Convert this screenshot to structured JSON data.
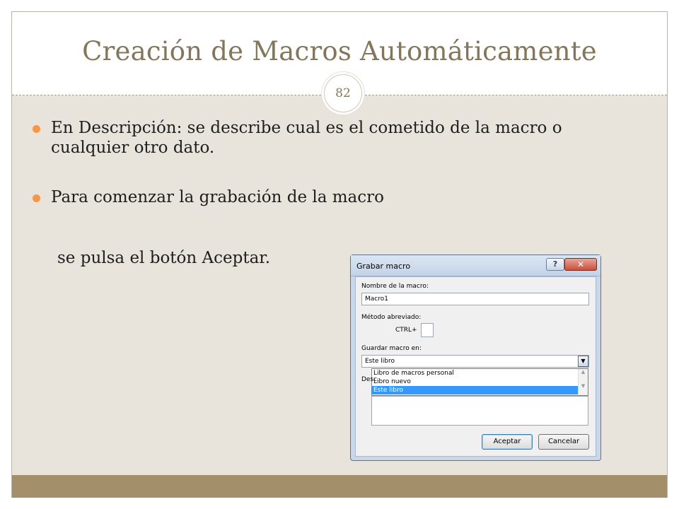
{
  "slide": {
    "title": "Creación de Macros Automáticamente",
    "page_number": "82",
    "bullets": [
      "En Descripción: se describe cual es el cometido de la macro o cualquier otro dato.",
      "Para comenzar la grabación de la macro"
    ],
    "continuation": "se pulsa el botón Aceptar."
  },
  "dialog": {
    "title": "Grabar macro",
    "help_label": "?",
    "close_label": "✕",
    "macro_name_label": "Nombre de la macro:",
    "macro_name_value": "Macro1",
    "shortcut_label": "Método abreviado:",
    "ctrl_label": "CTRL+",
    "shortcut_value": "",
    "store_label": "Guardar macro en:",
    "store_value": "Este libro",
    "store_options": [
      "Libro de macros personal",
      "Libro nuevo",
      "Este libro"
    ],
    "store_selected_index": 2,
    "description_label_partial": "Desc",
    "accept_label": "Aceptar",
    "cancel_label": "Cancelar"
  },
  "colors": {
    "title": "#84765a",
    "bullet": "#f79646",
    "content_bg": "#e8e4dc",
    "footer": "#a3906b",
    "selection": "#3399ff"
  }
}
